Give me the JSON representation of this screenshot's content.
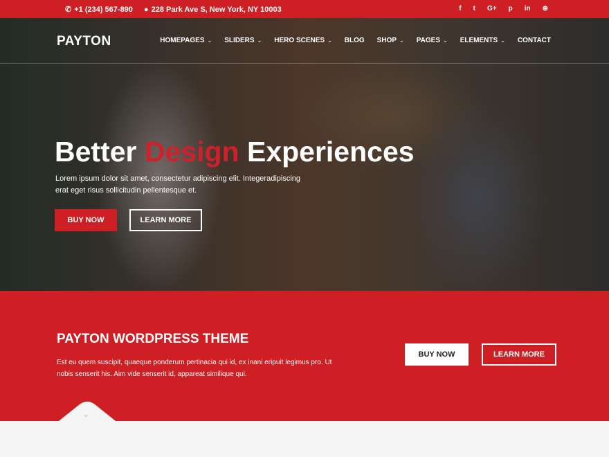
{
  "topbar": {
    "phone": "+1 (234) 567-890",
    "address": "228 Park Ave S, New York, NY 10003",
    "social": [
      {
        "icon": "facebook-icon",
        "glyph": "f"
      },
      {
        "icon": "twitter-icon",
        "glyph": "t"
      },
      {
        "icon": "google-plus-icon",
        "glyph": "G+"
      },
      {
        "icon": "pinterest-icon",
        "glyph": "p"
      },
      {
        "icon": "linkedin-icon",
        "glyph": "in"
      },
      {
        "icon": "dribbble-icon",
        "glyph": "⊛"
      }
    ]
  },
  "header": {
    "logo": "PAYTON",
    "menu": [
      {
        "label": "HOMEPAGES",
        "dropdown": true
      },
      {
        "label": "SLIDERS",
        "dropdown": true
      },
      {
        "label": "HERO SCENES",
        "dropdown": true
      },
      {
        "label": "BLOG",
        "dropdown": false
      },
      {
        "label": "SHOP",
        "dropdown": true
      },
      {
        "label": "PAGES",
        "dropdown": true
      },
      {
        "label": "ELEMENTS",
        "dropdown": true
      },
      {
        "label": "CONTACT",
        "dropdown": false
      }
    ]
  },
  "hero": {
    "headline_pre": "Better ",
    "headline_accent": "Design",
    "headline_post": " Experiences",
    "lead": "Lorem ipsum dolor sit amet, consectetur adipiscing elit. Integeradipiscing erat eget risus sollicitudin pellentesque et.",
    "buy_label": "BUY NOW",
    "learn_label": "LEARN MORE"
  },
  "band": {
    "title": "PAYTON WORDPRESS THEME",
    "text": "Est eu quem suscipit, quaeque ponderum pertinacia qui id, ex inani eripuit legimus pro. Ut nobis senserit his. Aim vide senserit id, appareat similique qui.",
    "buy_label": "BUY NOW",
    "learn_label": "LEARN MORE"
  },
  "colors": {
    "accent": "#cd1f24",
    "white": "#ffffff"
  }
}
